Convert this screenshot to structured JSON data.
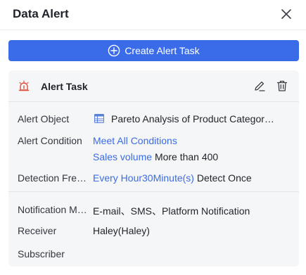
{
  "header": {
    "title": "Data Alert"
  },
  "create_button": {
    "label": "Create Alert Task"
  },
  "task": {
    "title": "Alert Task",
    "fields": {
      "alert_object": {
        "label": "Alert Object",
        "value": "Pareto Analysis of Product Categor…"
      },
      "alert_condition": {
        "label": "Alert Condition",
        "match": "Meet All Conditions",
        "metric": "Sales volume",
        "rule": "More than 400"
      },
      "detection_frequency": {
        "label": "Detection Fre…",
        "interval": "Every Hour30Minute(s)",
        "mode": "Detect Once"
      },
      "notification_method": {
        "label": "Notification M…",
        "value": "E-mail、SMS、Platform Notification"
      },
      "receiver": {
        "label": "Receiver",
        "value": "Haley(Haley)"
      },
      "subscriber": {
        "label": "Subscriber",
        "value": ""
      }
    }
  },
  "colors": {
    "accent": "#3a6be8",
    "bell": "#e0503c"
  }
}
